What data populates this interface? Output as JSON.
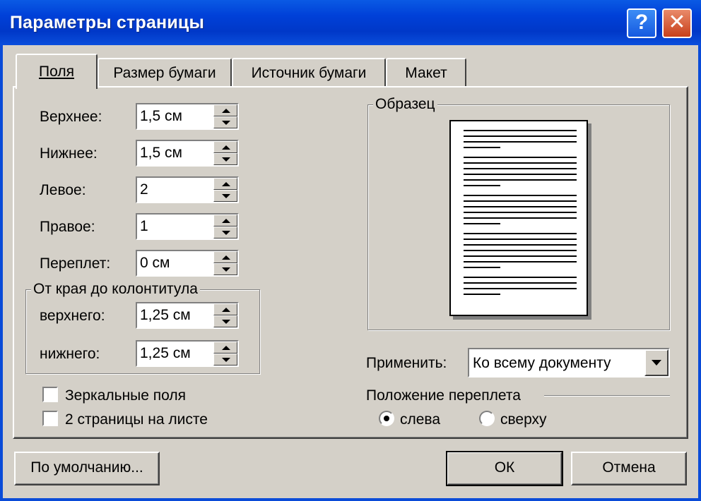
{
  "window": {
    "title": "Параметры страницы",
    "help_button": "?",
    "close_button": "✕",
    "accent_color": "#0a4bd8"
  },
  "tabs": [
    {
      "label": "Поля",
      "active": true
    },
    {
      "label": "Размер бумаги",
      "active": false
    },
    {
      "label": "Источник бумаги",
      "active": false
    },
    {
      "label": "Макет",
      "active": false
    }
  ],
  "margins": {
    "top": {
      "label": "Верхнее:",
      "value": "1,5 см"
    },
    "bottom": {
      "label": "Нижнее:",
      "value": "1,5 см"
    },
    "left": {
      "label": "Левое:",
      "value": "2"
    },
    "right": {
      "label": "Правое:",
      "value": "1"
    },
    "gutter": {
      "label": "Переплет:",
      "value": "0 см"
    }
  },
  "header_footer": {
    "legend": "От края до колонтитула",
    "header": {
      "label": "верхнего:",
      "value": "1,25 см"
    },
    "footer": {
      "label": "нижнего:",
      "value": "1,25 см"
    }
  },
  "options": {
    "mirror_margins": {
      "label": "Зеркальные поля",
      "checked": false
    },
    "two_pages": {
      "label": "2 страницы на листе",
      "checked": false
    }
  },
  "preview": {
    "legend": "Образец"
  },
  "apply": {
    "label": "Применить:",
    "value": "Ко всему документу"
  },
  "gutter_position": {
    "legend": "Положение переплета",
    "left": {
      "label": "слева",
      "selected": true
    },
    "top": {
      "label": "сверху",
      "selected": false
    }
  },
  "buttons": {
    "default": "По умолчанию...",
    "ok": "ОК",
    "cancel": "Отмена"
  }
}
